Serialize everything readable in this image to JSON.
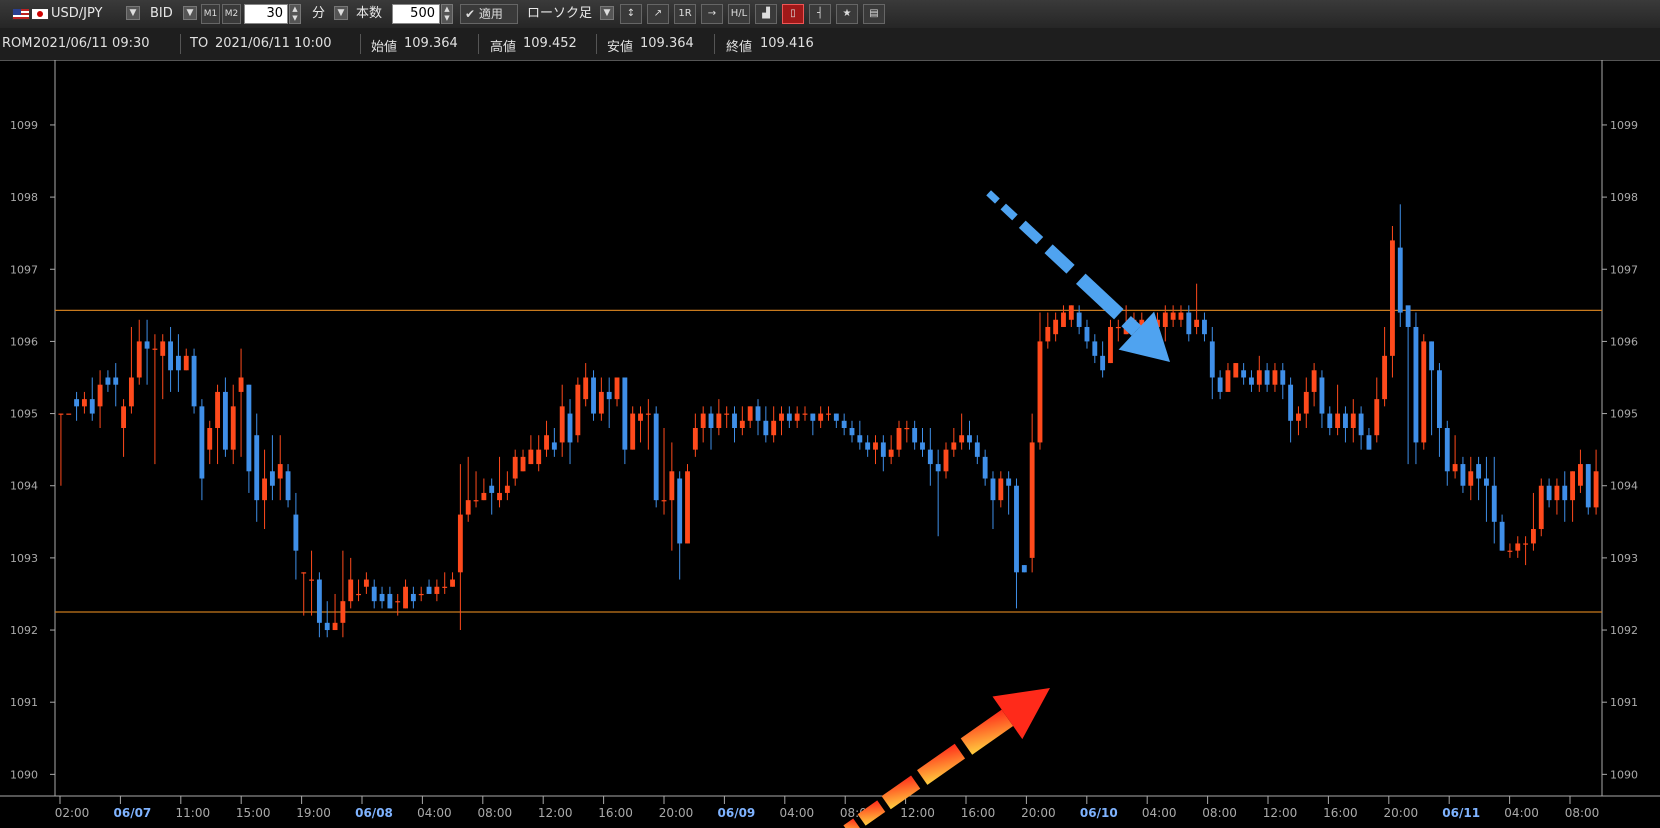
{
  "toolbar": {
    "pair_label": "USD/JPY",
    "price_type": "BID",
    "m1_label": "M1",
    "m2_label": "M2",
    "interval_value": "30",
    "interval_unit": "分",
    "count_label": "本数",
    "count_value": "500",
    "apply_label": "適用",
    "chart_type": "ローソク足",
    "tools": [
      "pos-icon",
      "trend-icon",
      "1r-icon",
      "line-icon",
      "hl-icon",
      "area-icon",
      "candle-icon",
      "bar-icon",
      "star-icon",
      "bar2-icon"
    ]
  },
  "info": {
    "from_label": "ROM",
    "from_value": "2021/06/11 09:30",
    "to_label": "TO",
    "to_value": "2021/06/11 10:00",
    "open_label": "始値",
    "open_value": "109.364",
    "high_label": "高値",
    "high_value": "109.452",
    "low_label": "安値",
    "low_value": "109.364",
    "close_label": "終値",
    "close_value": "109.416"
  },
  "colors": {
    "up": "#ff4a1c",
    "down": "#3f8fe8",
    "hline": "#c87a1e",
    "arrow_blue": "#4fa3f0",
    "arrow_red_start": "#ffd040",
    "arrow_red_end": "#ff2a1a"
  },
  "chart_data": {
    "type": "candlestick",
    "ylim": [
      108.97,
      109.99
    ],
    "y_ticks": [
      "1090",
      "1091",
      "1092",
      "1093",
      "1094",
      "1095",
      "1096",
      "1097",
      "1098",
      "1099"
    ],
    "x_ticks": [
      {
        "label": "02:00",
        "date": false
      },
      {
        "label": "06/07",
        "date": true
      },
      {
        "label": "11:00",
        "date": false
      },
      {
        "label": "15:00",
        "date": false
      },
      {
        "label": "19:00",
        "date": false
      },
      {
        "label": "06/08",
        "date": true
      },
      {
        "label": "04:00",
        "date": false
      },
      {
        "label": "08:00",
        "date": false
      },
      {
        "label": "12:00",
        "date": false
      },
      {
        "label": "16:00",
        "date": false
      },
      {
        "label": "20:00",
        "date": false
      },
      {
        "label": "06/09",
        "date": true
      },
      {
        "label": "04:00",
        "date": false
      },
      {
        "label": "08:00",
        "date": false
      },
      {
        "label": "12:00",
        "date": false
      },
      {
        "label": "16:00",
        "date": false
      },
      {
        "label": "20:00",
        "date": false
      },
      {
        "label": "06/10",
        "date": true
      },
      {
        "label": "04:00",
        "date": false
      },
      {
        "label": "08:00",
        "date": false
      },
      {
        "label": "12:00",
        "date": false
      },
      {
        "label": "16:00",
        "date": false
      },
      {
        "label": "20:00",
        "date": false
      },
      {
        "label": "06/11",
        "date": true
      },
      {
        "label": "04:00",
        "date": false
      },
      {
        "label": "08:00",
        "date": false
      }
    ],
    "horizontal_lines": [
      109.643,
      109.225
    ],
    "candles": [
      [
        109.5,
        109.5,
        109.5,
        109.4
      ],
      [
        109.5,
        109.5,
        109.5,
        109.5
      ],
      [
        109.52,
        109.51,
        109.53,
        109.49
      ],
      [
        109.51,
        109.52,
        109.53,
        109.5
      ],
      [
        109.52,
        109.5,
        109.55,
        109.49
      ],
      [
        109.51,
        109.54,
        109.56,
        109.48
      ],
      [
        109.55,
        109.54,
        109.56,
        109.53
      ],
      [
        109.55,
        109.54,
        109.57,
        109.51
      ],
      [
        109.48,
        109.51,
        109.52,
        109.44
      ],
      [
        109.51,
        109.55,
        109.62,
        109.5
      ],
      [
        109.55,
        109.6,
        109.63,
        109.54
      ],
      [
        109.6,
        109.59,
        109.63,
        109.54
      ],
      [
        109.59,
        109.59,
        109.61,
        109.43
      ],
      [
        109.58,
        109.6,
        109.61,
        109.52
      ],
      [
        109.6,
        109.56,
        109.62,
        109.53
      ],
      [
        109.58,
        109.56,
        109.61,
        109.53
      ],
      [
        109.56,
        109.58,
        109.59,
        109.56
      ],
      [
        109.58,
        109.51,
        109.59,
        109.5
      ],
      [
        109.51,
        109.41,
        109.52,
        109.38
      ],
      [
        109.45,
        109.48,
        109.49,
        109.43
      ],
      [
        109.48,
        109.53,
        109.54,
        109.43
      ],
      [
        109.53,
        109.45,
        109.55,
        109.44
      ],
      [
        109.45,
        109.51,
        109.54,
        109.43
      ],
      [
        109.53,
        109.55,
        109.59,
        109.44
      ],
      [
        109.54,
        109.42,
        109.54,
        109.39
      ],
      [
        109.47,
        109.38,
        109.5,
        109.35
      ],
      [
        109.38,
        109.41,
        109.45,
        109.34
      ],
      [
        109.42,
        109.4,
        109.47,
        109.38
      ],
      [
        109.41,
        109.43,
        109.47,
        109.38
      ],
      [
        109.42,
        109.38,
        109.43,
        109.37
      ],
      [
        109.36,
        109.31,
        109.39,
        109.27
      ],
      [
        109.28,
        109.28,
        109.28,
        109.22
      ],
      [
        109.27,
        109.27,
        109.31,
        109.22
      ],
      [
        109.27,
        109.21,
        109.28,
        109.19
      ],
      [
        109.21,
        109.2,
        109.24,
        109.19
      ],
      [
        109.2,
        109.21,
        109.25,
        109.2
      ],
      [
        109.21,
        109.24,
        109.31,
        109.19
      ],
      [
        109.24,
        109.27,
        109.3,
        109.23
      ],
      [
        109.25,
        109.25,
        109.27,
        109.24
      ],
      [
        109.26,
        109.27,
        109.28,
        109.25
      ],
      [
        109.26,
        109.24,
        109.27,
        109.23
      ],
      [
        109.25,
        109.24,
        109.26,
        109.23
      ],
      [
        109.25,
        109.23,
        109.26,
        109.23
      ],
      [
        109.24,
        109.24,
        109.25,
        109.22
      ],
      [
        109.23,
        109.26,
        109.27,
        109.23
      ],
      [
        109.25,
        109.24,
        109.26,
        109.23
      ],
      [
        109.25,
        109.25,
        109.26,
        109.24
      ],
      [
        109.26,
        109.25,
        109.27,
        109.25
      ],
      [
        109.25,
        109.26,
        109.27,
        109.24
      ],
      [
        109.26,
        109.26,
        109.28,
        109.25
      ],
      [
        109.26,
        109.27,
        109.28,
        109.26
      ],
      [
        109.28,
        109.36,
        109.43,
        109.2
      ],
      [
        109.36,
        109.38,
        109.44,
        109.35
      ],
      [
        109.38,
        109.38,
        109.42,
        109.37
      ],
      [
        109.38,
        109.39,
        109.41,
        109.38
      ],
      [
        109.4,
        109.39,
        109.41,
        109.36
      ],
      [
        109.38,
        109.39,
        109.44,
        109.37
      ],
      [
        109.39,
        109.4,
        109.42,
        109.38
      ],
      [
        109.41,
        109.44,
        109.45,
        109.4
      ],
      [
        109.42,
        109.44,
        109.45,
        109.42
      ],
      [
        109.43,
        109.45,
        109.47,
        109.43
      ],
      [
        109.43,
        109.45,
        109.47,
        109.42
      ],
      [
        109.45,
        109.47,
        109.49,
        109.44
      ],
      [
        109.46,
        109.45,
        109.48,
        109.44
      ],
      [
        109.46,
        109.51,
        109.54,
        109.44
      ],
      [
        109.5,
        109.46,
        109.52,
        109.43
      ],
      [
        109.47,
        109.54,
        109.55,
        109.46
      ],
      [
        109.52,
        109.55,
        109.57,
        109.51
      ],
      [
        109.55,
        109.5,
        109.56,
        109.49
      ],
      [
        109.5,
        109.53,
        109.55,
        109.49
      ],
      [
        109.53,
        109.52,
        109.55,
        109.48
      ],
      [
        109.52,
        109.55,
        109.55,
        109.51
      ],
      [
        109.55,
        109.45,
        109.55,
        109.43
      ],
      [
        109.45,
        109.5,
        109.51,
        109.45
      ],
      [
        109.49,
        109.5,
        109.51,
        109.46
      ],
      [
        109.5,
        109.5,
        109.52,
        109.45
      ],
      [
        109.5,
        109.38,
        109.51,
        109.37
      ],
      [
        109.38,
        109.38,
        109.48,
        109.36
      ],
      [
        109.38,
        109.42,
        109.46,
        109.31
      ],
      [
        109.41,
        109.32,
        109.42,
        109.27
      ],
      [
        109.32,
        109.42,
        109.43,
        109.32
      ],
      [
        109.45,
        109.48,
        109.5,
        109.44
      ],
      [
        109.48,
        109.5,
        109.51,
        109.46
      ],
      [
        109.5,
        109.48,
        109.51,
        109.45
      ],
      [
        109.48,
        109.5,
        109.52,
        109.47
      ],
      [
        109.5,
        109.5,
        109.51,
        109.48
      ],
      [
        109.5,
        109.48,
        109.51,
        109.46
      ],
      [
        109.48,
        109.49,
        109.51,
        109.47
      ],
      [
        109.49,
        109.51,
        109.51,
        109.48
      ],
      [
        109.51,
        109.49,
        109.52,
        109.47
      ],
      [
        109.49,
        109.47,
        109.51,
        109.46
      ],
      [
        109.47,
        109.49,
        109.51,
        109.46
      ],
      [
        109.49,
        109.5,
        109.51,
        109.47
      ],
      [
        109.5,
        109.49,
        109.51,
        109.48
      ],
      [
        109.49,
        109.5,
        109.51,
        109.48
      ],
      [
        109.5,
        109.5,
        109.51,
        109.49
      ],
      [
        109.5,
        109.49,
        109.5,
        109.47
      ],
      [
        109.49,
        109.5,
        109.51,
        109.48
      ],
      [
        109.5,
        109.5,
        109.51,
        109.49
      ],
      [
        109.5,
        109.49,
        109.5,
        109.48
      ],
      [
        109.49,
        109.48,
        109.5,
        109.47
      ],
      [
        109.48,
        109.47,
        109.49,
        109.46
      ],
      [
        109.47,
        109.46,
        109.49,
        109.45
      ],
      [
        109.46,
        109.45,
        109.47,
        109.44
      ],
      [
        109.45,
        109.46,
        109.47,
        109.43
      ],
      [
        109.46,
        109.44,
        109.47,
        109.42
      ],
      [
        109.44,
        109.45,
        109.47,
        109.43
      ],
      [
        109.45,
        109.48,
        109.49,
        109.44
      ],
      [
        109.48,
        109.48,
        109.49,
        109.46
      ],
      [
        109.48,
        109.46,
        109.49,
        109.45
      ],
      [
        109.46,
        109.45,
        109.48,
        109.44
      ],
      [
        109.45,
        109.43,
        109.48,
        109.4
      ],
      [
        109.43,
        109.42,
        109.45,
        109.33
      ],
      [
        109.42,
        109.45,
        109.46,
        109.41
      ],
      [
        109.45,
        109.46,
        109.48,
        109.44
      ],
      [
        109.46,
        109.47,
        109.5,
        109.45
      ],
      [
        109.47,
        109.46,
        109.49,
        109.45
      ],
      [
        109.46,
        109.44,
        109.47,
        109.43
      ],
      [
        109.44,
        109.41,
        109.45,
        109.4
      ],
      [
        109.41,
        109.38,
        109.42,
        109.34
      ],
      [
        109.38,
        109.41,
        109.42,
        109.37
      ],
      [
        109.41,
        109.4,
        109.42,
        109.36
      ],
      [
        109.4,
        109.28,
        109.41,
        109.23
      ],
      [
        109.29,
        109.28,
        109.29,
        109.28
      ],
      [
        109.3,
        109.46,
        109.5,
        109.28
      ],
      [
        109.46,
        109.6,
        109.64,
        109.45
      ],
      [
        109.6,
        109.62,
        109.64,
        109.59
      ],
      [
        109.61,
        109.63,
        109.64,
        109.6
      ],
      [
        109.62,
        109.64,
        109.65,
        109.62
      ],
      [
        109.63,
        109.65,
        109.65,
        109.62
      ],
      [
        109.64,
        109.62,
        109.65,
        109.61
      ],
      [
        109.62,
        109.6,
        109.63,
        109.59
      ],
      [
        109.6,
        109.58,
        109.61,
        109.57
      ],
      [
        109.58,
        109.56,
        109.6,
        109.55
      ],
      [
        109.57,
        109.62,
        109.63,
        109.57
      ],
      [
        109.62,
        109.62,
        109.63,
        109.6
      ],
      [
        109.61,
        109.62,
        109.65,
        109.61
      ],
      [
        109.62,
        109.63,
        109.64,
        109.61
      ],
      [
        109.62,
        109.63,
        109.64,
        109.62
      ],
      [
        109.6,
        109.61,
        109.62,
        109.59
      ],
      [
        109.62,
        109.63,
        109.64,
        109.61
      ],
      [
        109.62,
        109.64,
        109.65,
        109.6
      ],
      [
        109.63,
        109.64,
        109.65,
        109.62
      ],
      [
        109.63,
        109.64,
        109.65,
        109.62
      ],
      [
        109.64,
        109.61,
        109.65,
        109.6
      ],
      [
        109.62,
        109.63,
        109.68,
        109.61
      ],
      [
        109.63,
        109.61,
        109.64,
        109.6
      ],
      [
        109.6,
        109.55,
        109.62,
        109.52
      ],
      [
        109.55,
        109.53,
        109.56,
        109.52
      ],
      [
        109.53,
        109.56,
        109.57,
        109.53
      ],
      [
        109.55,
        109.57,
        109.57,
        109.55
      ],
      [
        109.56,
        109.55,
        109.57,
        109.54
      ],
      [
        109.55,
        109.54,
        109.56,
        109.53
      ],
      [
        109.54,
        109.56,
        109.58,
        109.53
      ],
      [
        109.56,
        109.54,
        109.57,
        109.53
      ],
      [
        109.54,
        109.56,
        109.57,
        109.53
      ],
      [
        109.56,
        109.54,
        109.57,
        109.52
      ],
      [
        109.54,
        109.49,
        109.55,
        109.46
      ],
      [
        109.49,
        109.5,
        109.51,
        109.47
      ],
      [
        109.5,
        109.53,
        109.55,
        109.48
      ],
      [
        109.53,
        109.56,
        109.57,
        109.51
      ],
      [
        109.55,
        109.5,
        109.56,
        109.48
      ],
      [
        109.5,
        109.48,
        109.51,
        109.47
      ],
      [
        109.48,
        109.5,
        109.54,
        109.47
      ],
      [
        109.5,
        109.48,
        109.51,
        109.46
      ],
      [
        109.48,
        109.5,
        109.52,
        109.46
      ],
      [
        109.5,
        109.47,
        109.51,
        109.45
      ],
      [
        109.47,
        109.45,
        109.48,
        109.45
      ],
      [
        109.47,
        109.52,
        109.55,
        109.46
      ],
      [
        109.52,
        109.58,
        109.62,
        109.51
      ],
      [
        109.58,
        109.74,
        109.76,
        109.55
      ],
      [
        109.73,
        109.64,
        109.79,
        109.62
      ],
      [
        109.65,
        109.62,
        109.64,
        109.43
      ],
      [
        109.62,
        109.46,
        109.64,
        109.43
      ],
      [
        109.46,
        109.6,
        109.61,
        109.45
      ],
      [
        109.6,
        109.56,
        109.6,
        109.47
      ],
      [
        109.56,
        109.48,
        109.57,
        109.44
      ],
      [
        109.48,
        109.42,
        109.49,
        109.4
      ],
      [
        109.42,
        109.43,
        109.47,
        109.41
      ],
      [
        109.43,
        109.4,
        109.44,
        109.39
      ],
      [
        109.4,
        109.42,
        109.44,
        109.38
      ],
      [
        109.43,
        109.41,
        109.44,
        109.38
      ],
      [
        109.41,
        109.4,
        109.44,
        109.35
      ],
      [
        109.4,
        109.35,
        109.44,
        109.32
      ],
      [
        109.35,
        109.31,
        109.36,
        109.31
      ],
      [
        109.31,
        109.31,
        109.32,
        109.3
      ],
      [
        109.31,
        109.32,
        109.33,
        109.3
      ],
      [
        109.32,
        109.32,
        109.33,
        109.29
      ],
      [
        109.32,
        109.34,
        109.39,
        109.31
      ],
      [
        109.34,
        109.4,
        109.41,
        109.33
      ],
      [
        109.4,
        109.38,
        109.41,
        109.37
      ],
      [
        109.38,
        109.4,
        109.41,
        109.36
      ],
      [
        109.4,
        109.38,
        109.42,
        109.35
      ],
      [
        109.38,
        109.42,
        109.42,
        109.35
      ],
      [
        109.4,
        109.43,
        109.45,
        109.39
      ],
      [
        109.43,
        109.37,
        109.43,
        109.36
      ],
      [
        109.37,
        109.42,
        109.45,
        109.36
      ]
    ]
  }
}
